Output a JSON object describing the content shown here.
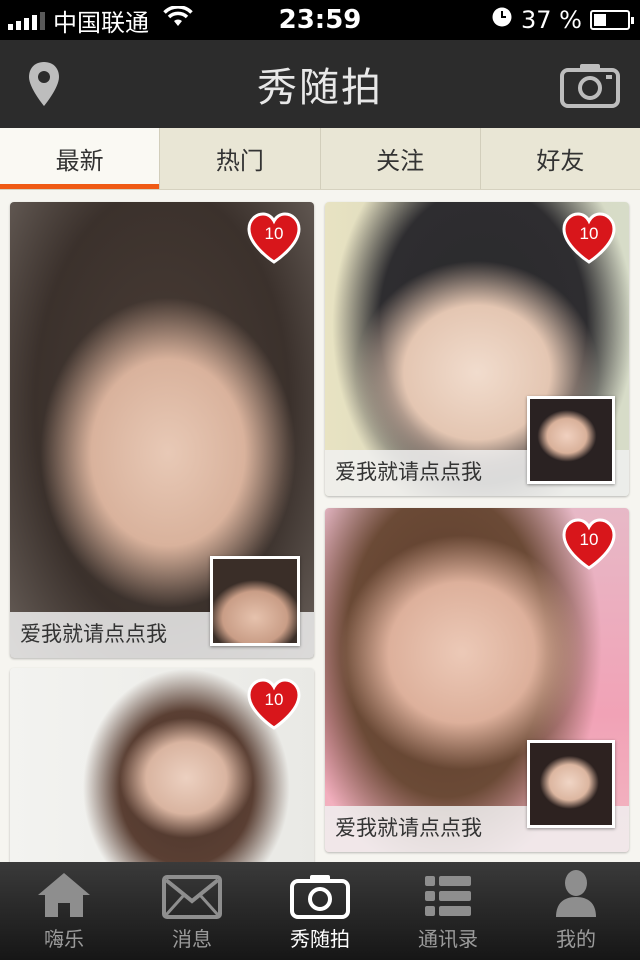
{
  "status_bar": {
    "carrier": "中国联通",
    "time": "23:59",
    "battery": "37 %",
    "battery_level": 0.37
  },
  "nav": {
    "title": "秀随拍",
    "left_icon": "location-pin-icon",
    "right_icon": "camera-icon"
  },
  "tabs": [
    {
      "label": "最新",
      "active": true
    },
    {
      "label": "热门",
      "active": false
    },
    {
      "label": "关注",
      "active": false
    },
    {
      "label": "好友",
      "active": false
    }
  ],
  "feed": {
    "cards": [
      {
        "likes": "10",
        "caption": "爱我就请点点我"
      },
      {
        "likes": "10",
        "caption": "爱我就请点点我"
      },
      {
        "likes": "10",
        "caption": ""
      },
      {
        "likes": "10",
        "caption": "爱我就请点点我"
      }
    ]
  },
  "tabbar": [
    {
      "label": "嗨乐",
      "icon": "home-icon",
      "active": false
    },
    {
      "label": "消息",
      "icon": "envelope-icon",
      "active": false
    },
    {
      "label": "秀随拍",
      "icon": "camera-icon",
      "active": true
    },
    {
      "label": "通讯录",
      "icon": "list-icon",
      "active": false
    },
    {
      "label": "我的",
      "icon": "person-icon",
      "active": false
    }
  ],
  "colors": {
    "accent": "#f05a14",
    "heart": "#d8161b",
    "navbar": "#2c2c2c"
  }
}
